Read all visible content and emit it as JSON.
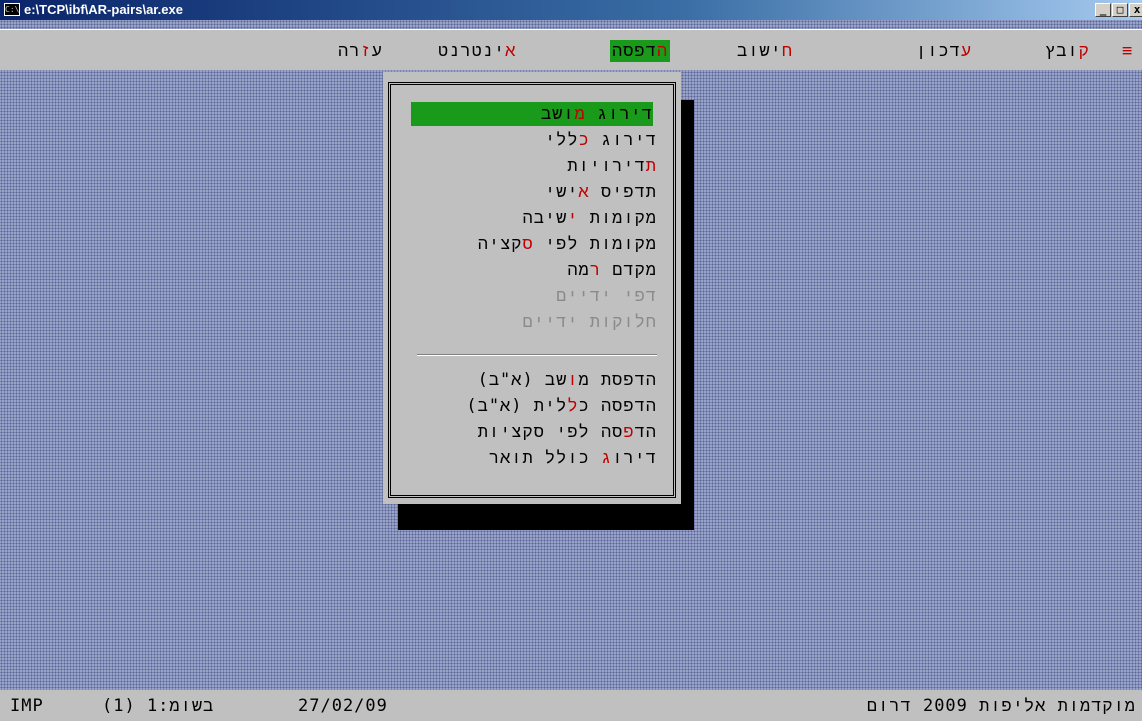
{
  "window": {
    "title": "e:\\TCP\\ibf\\AR-pairs\\ar.exe",
    "app_icon": "C:\\",
    "buttons": {
      "minimize": "_",
      "maximize": "□",
      "close": "x"
    }
  },
  "menubar": {
    "system": "≡",
    "items": [
      {
        "label": "קובץ",
        "hot": "ק",
        "rest": "ובץ"
      },
      {
        "label": "עדכון",
        "hot": "ע",
        "rest": "דכון"
      },
      {
        "label": "חישוב",
        "hot": "ח",
        "rest": "ישוב"
      },
      {
        "label": "הדפסה",
        "hot": "ה",
        "rest": "דפסה"
      },
      {
        "label": "אינטרנט",
        "hot": "א",
        "rest": "ינטרנט"
      },
      {
        "label": "עזרה",
        "pre": "ע",
        "hot": "ז",
        "rest": "רה"
      }
    ]
  },
  "print_menu": {
    "items": [
      {
        "pre": "דירוג ",
        "hot": "מ",
        "rest": "ושב",
        "selected": true
      },
      {
        "pre": "דירוג ",
        "hot": "כ",
        "rest": "ללי"
      },
      {
        "pre": "",
        "hot": "ת",
        "rest": "דירויות"
      },
      {
        "pre": "תדפיס ",
        "hot": "א",
        "rest": "ישי"
      },
      {
        "pre": "מקומות ",
        "hot": "י",
        "rest": "שיבה"
      },
      {
        "pre": "מקומות לפי ",
        "hot": "ס",
        "rest": "קציה"
      },
      {
        "pre": "מקדם ",
        "hot": "ר",
        "rest": "מה"
      },
      {
        "label": "דפי ידיים",
        "disabled": true
      },
      {
        "label": "חלוקות ידיים",
        "disabled": true
      },
      {
        "pre": "הדפסת מ",
        "hot": "ו",
        "rest": "שב (א\"ב)"
      },
      {
        "pre": "הדפסה כ",
        "hot": "ל",
        "rest": "לית (א\"ב)"
      },
      {
        "pre": "הד",
        "hot": "פ",
        "rest": "סה לפי סקציות"
      },
      {
        "pre": "דירו",
        "hot": "ג",
        "rest": " כולל תואר"
      }
    ]
  },
  "status": {
    "mode": "IMP",
    "session": "(1) 1:מושב",
    "date": "27/02/09",
    "event": "מוקדמות אליפות 2009 דרום"
  }
}
